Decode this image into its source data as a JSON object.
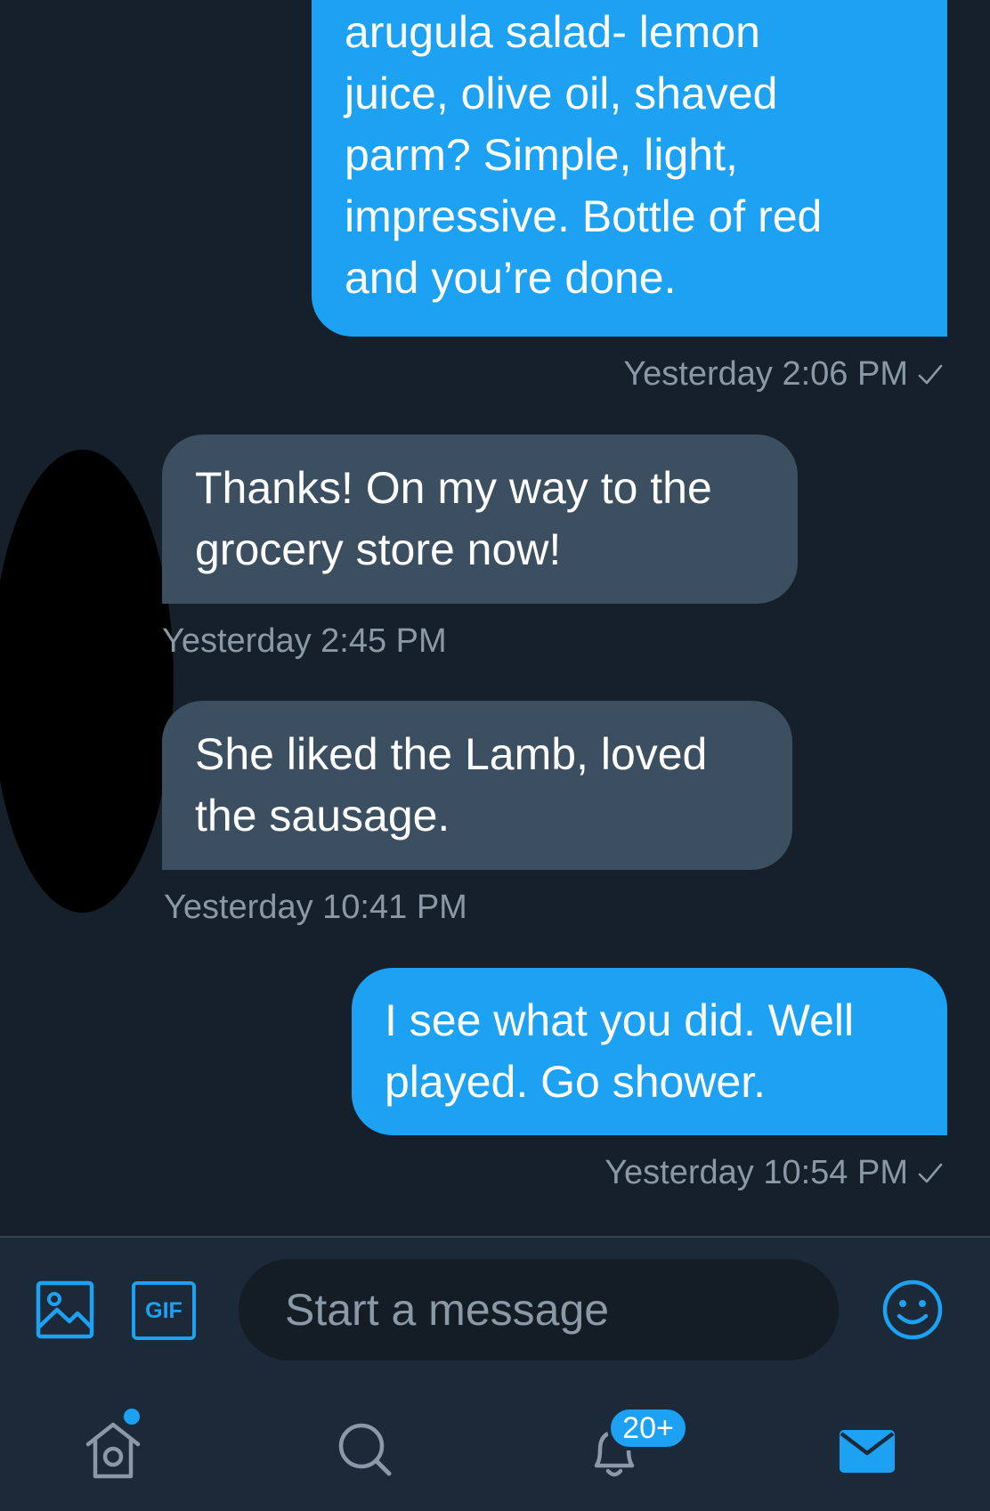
{
  "messages": [
    {
      "direction": "out",
      "text": "arugula salad- lemon\njuice, olive oil, shaved\nparm?   Simple, light,\nimpressive.   Bottle of red\nand you’re done.",
      "timestamp": "Yesterday 2:06 PM"
    },
    {
      "direction": "in",
      "text": "Thanks! On my way to the\ngrocery store now!",
      "timestamp": "Yesterday 2:45 PM"
    },
    {
      "direction": "in",
      "text": "She liked the Lamb, loved\nthe sausage.",
      "timestamp": "Yesterday 10:41 PM"
    },
    {
      "direction": "out",
      "text": "I see what you did.  Well\nplayed.  Go shower.",
      "timestamp": "Yesterday 10:54 PM"
    }
  ],
  "composer": {
    "placeholder": "Start a message",
    "gif_label": "GIF"
  },
  "tabbar": {
    "notifications_badge": "20+"
  },
  "colors": {
    "background": "#15202b",
    "accent": "#1da1f2",
    "incoming_bubble": "#3c4f61",
    "secondary_text": "#8b98a5"
  },
  "icons": [
    "image-icon",
    "gif-icon",
    "emoji-icon",
    "home-icon",
    "search-icon",
    "notifications-icon",
    "messages-icon"
  ]
}
